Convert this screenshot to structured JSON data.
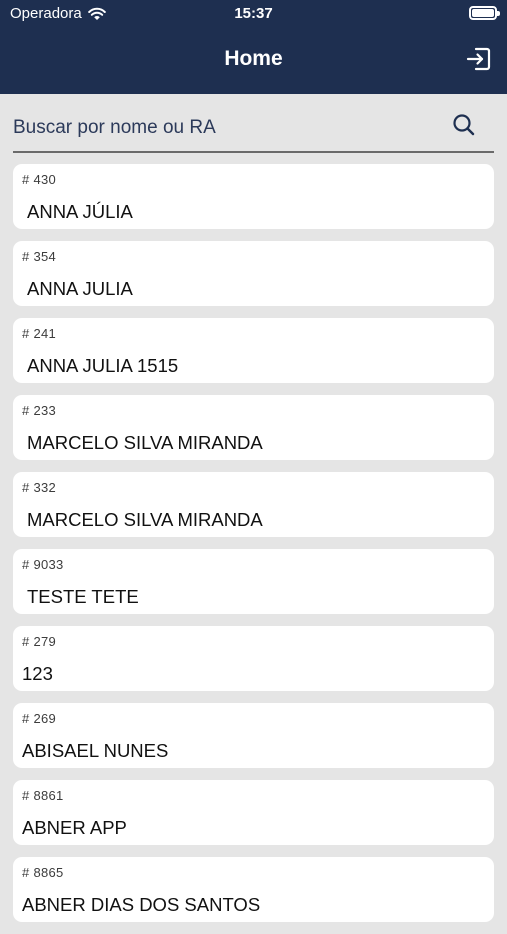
{
  "status_bar": {
    "carrier": "Operadora",
    "time": "15:37"
  },
  "header": {
    "title": "Home"
  },
  "search": {
    "placeholder": "Buscar por nome ou RA"
  },
  "students": [
    {
      "id_label": "# 430",
      "name": "ANNA JÚLIA",
      "indent": true
    },
    {
      "id_label": "# 354",
      "name": "ANNA JULIA",
      "indent": true
    },
    {
      "id_label": "# 241",
      "name": "ANNA JULIA 1515",
      "indent": true
    },
    {
      "id_label": "# 233",
      "name": "MARCELO SILVA MIRANDA",
      "indent": true
    },
    {
      "id_label": "# 332",
      "name": "MARCELO SILVA MIRANDA",
      "indent": true
    },
    {
      "id_label": "# 9033",
      "name": "TESTE TETE",
      "indent": true
    },
    {
      "id_label": "# 279",
      "name": "123",
      "indent": false
    },
    {
      "id_label": "# 269",
      "name": "ABISAEL NUNES",
      "indent": false
    },
    {
      "id_label": "# 8861",
      "name": "ABNER APP",
      "indent": false
    },
    {
      "id_label": "# 8865",
      "name": "ABNER DIAS DOS SANTOS",
      "indent": false
    }
  ]
}
